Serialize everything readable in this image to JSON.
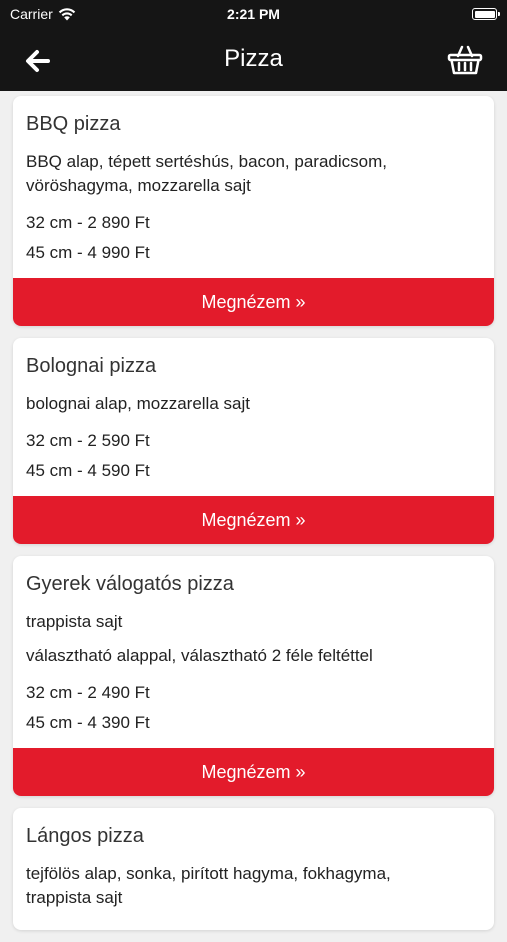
{
  "status_bar": {
    "carrier": "Carrier",
    "time": "2:21 PM"
  },
  "header": {
    "title": "Pizza",
    "back_icon": "arrow-left-icon",
    "cart_icon": "basket-icon"
  },
  "colors": {
    "header_bg": "#151515",
    "accent_button": "#e31b2b",
    "page_bg": "#f0f0f0"
  },
  "products": [
    {
      "name": "BBQ pizza",
      "description_lines": [
        "BBQ alap, tépett sertéshús, bacon, paradicsom,",
        "vöröshagyma, mozzarella sajt"
      ],
      "extra": "",
      "sizes": [
        "32 cm - 2 890 Ft",
        "45 cm - 4 990 Ft"
      ],
      "button_label": "Megnézem »"
    },
    {
      "name": "Bolognai pizza",
      "description_lines": [
        "bolognai alap, mozzarella sajt"
      ],
      "extra": "",
      "sizes": [
        "32 cm - 2 590 Ft",
        "45 cm - 4 590 Ft"
      ],
      "button_label": "Megnézem »"
    },
    {
      "name": "Gyerek válogatós pizza",
      "description_lines": [
        "trappista sajt"
      ],
      "extra": "választható alappal, választható 2 féle feltéttel",
      "sizes": [
        "32 cm - 2 490 Ft",
        "45 cm - 4 390 Ft"
      ],
      "button_label": "Megnézem »"
    },
    {
      "name": "Lángos pizza",
      "description_lines": [
        "tejfölös alap, sonka, pirított hagyma, fokhagyma,",
        "trappista sajt"
      ],
      "extra": "",
      "sizes": [],
      "button_label": ""
    }
  ]
}
